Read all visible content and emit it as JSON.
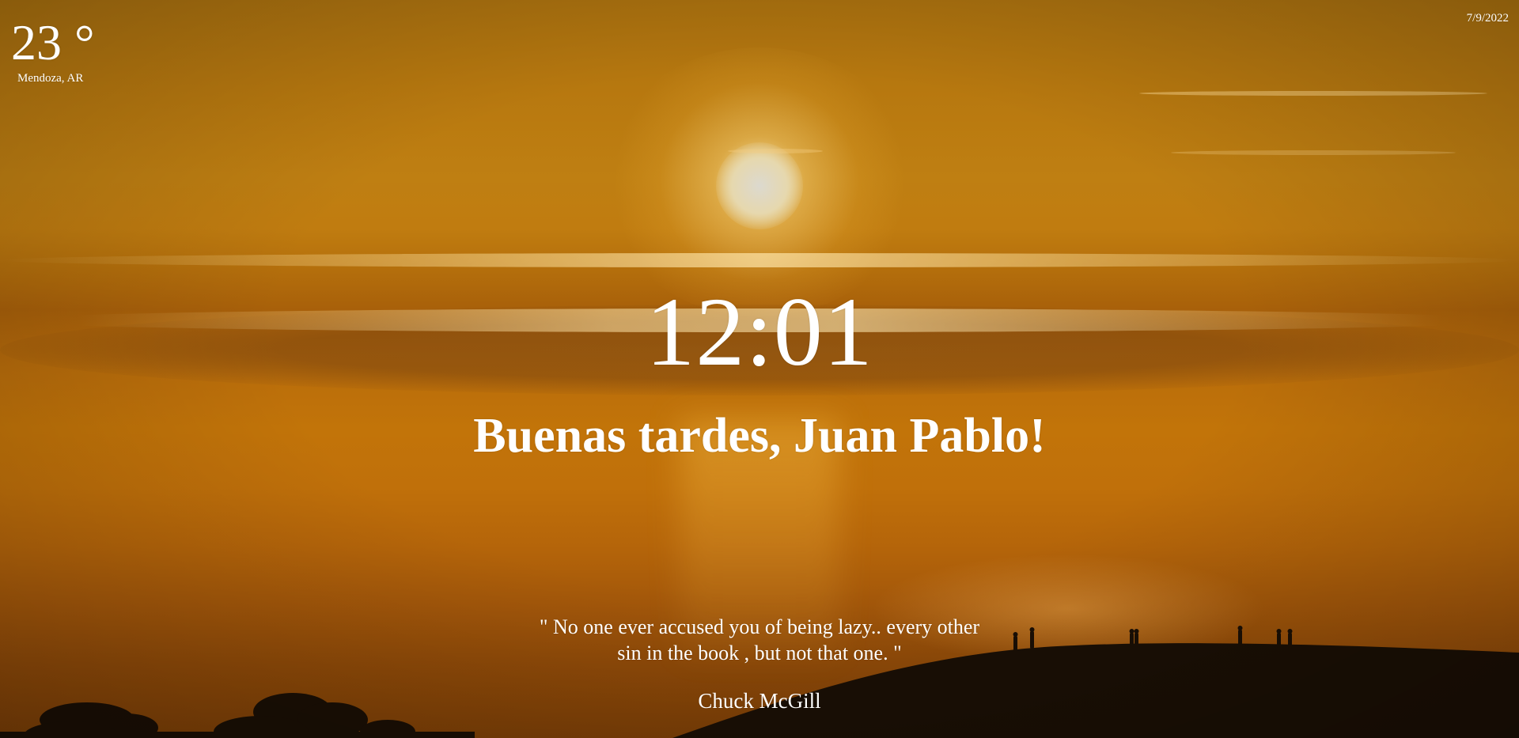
{
  "weather": {
    "temperature": "23 °",
    "location": "Mendoza, AR"
  },
  "date": "7/9/2022",
  "clock": "12:01",
  "greeting": "Buenas tardes, Juan Pablo!",
  "quote": {
    "text": "\" No one ever accused you of being lazy.. every other sin in the book , but not that one. \"",
    "author": "Chuck McGill"
  },
  "background": {
    "icon": "sunset-photo",
    "accent": "#c07c10"
  }
}
